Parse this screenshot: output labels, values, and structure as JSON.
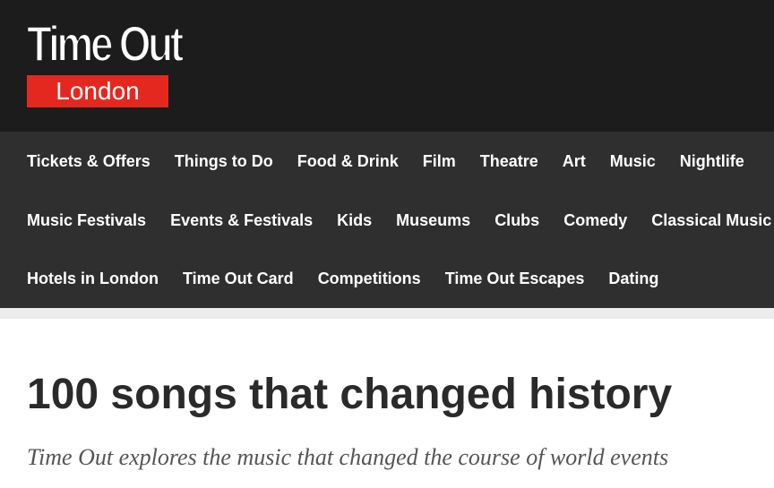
{
  "brand": {
    "logo_top": "Time Out",
    "logo_bottom": "London",
    "accent_color": "#e5281f"
  },
  "nav": {
    "rows": [
      [
        "Tickets & Offers",
        "Things to Do",
        "Food & Drink",
        "Film",
        "Theatre",
        "Art",
        "Music",
        "Nightlife"
      ],
      [
        "Music Festivals",
        "Events & Festivals",
        "Kids",
        "Museums",
        "Clubs",
        "Comedy",
        "Classical Music"
      ],
      [
        "Hotels in London",
        "Time Out Card",
        "Competitions",
        "Time Out Escapes",
        "Dating"
      ]
    ]
  },
  "article": {
    "title": "100 songs that changed history",
    "subtitle": "Time Out explores the music that changed the course of world events"
  }
}
